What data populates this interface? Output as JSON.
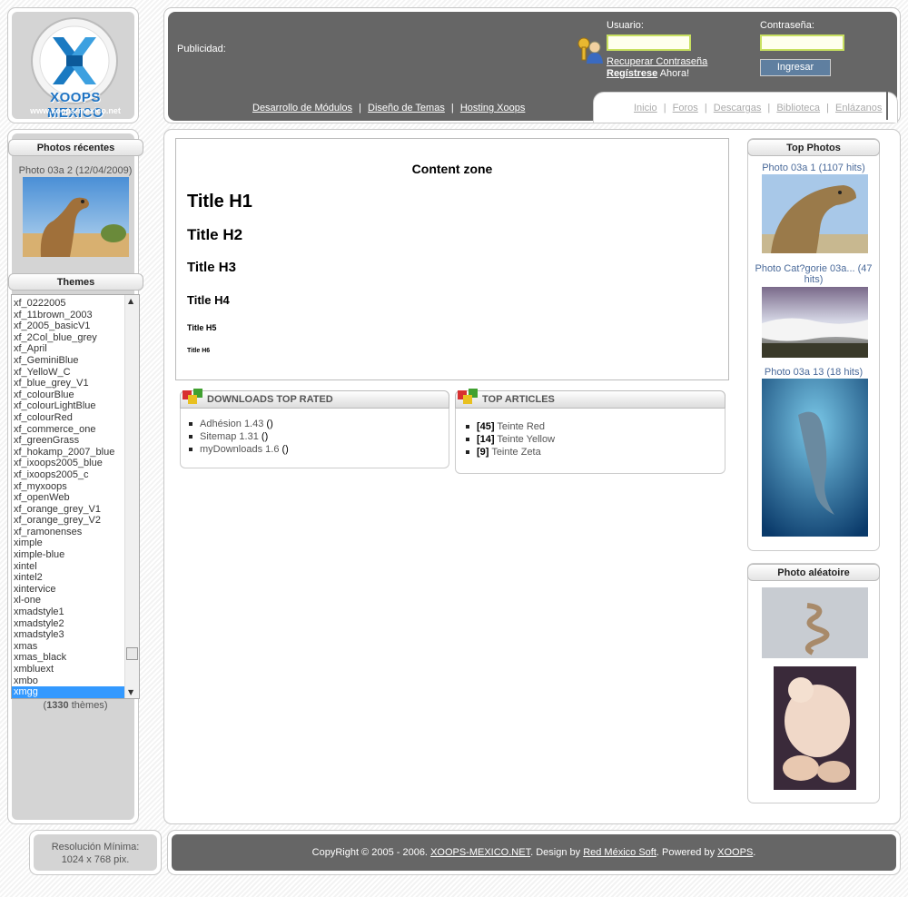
{
  "logo": {
    "title": "XOOPS MEXICO",
    "url_text": "www.xoops-mexico.net"
  },
  "header": {
    "ad_label": "Publicidad:",
    "links": [
      "Desarrollo de Módulos",
      "Diseño de Temas",
      "Hosting Xoops"
    ],
    "separator": "|",
    "username_label": "Usuario:",
    "password_label": "Contraseña:",
    "recover_link": "Recuperar Contraseña",
    "register_link": "Regístrese",
    "register_suffix": "Ahora!",
    "login_button": "Ingresar",
    "nav": [
      "Inicio",
      "Foros",
      "Descargas",
      "Biblioteca",
      "Enlázanos"
    ]
  },
  "left": {
    "recent_title": "Photos récentes",
    "recent_caption": "Photo 03a 2 (12/04/2009)",
    "themes_title": "Themes",
    "themes": [
      "xf_0222005",
      "xf_11brown_2003",
      "xf_2005_basicV1",
      "xf_2Col_blue_grey",
      "xf_April",
      "xf_GeminiBlue",
      "xf_YelloW_C",
      "xf_blue_grey_V1",
      "xf_colourBlue",
      "xf_colourLightBlue",
      "xf_colourRed",
      "xf_commerce_one",
      "xf_greenGrass",
      "xf_hokamp_2007_blue",
      "xf_ixoops2005_blue",
      "xf_ixoops2005_c",
      "xf_myxoops",
      "xf_openWeb",
      "xf_orange_grey_V1",
      "xf_orange_grey_V2",
      "xf_ramonenses",
      "ximple",
      "ximple-blue",
      "xintel",
      "xintel2",
      "xintervice",
      "xl-one",
      "xmadstyle1",
      "xmadstyle2",
      "xmadstyle3",
      "xmas",
      "xmas_black",
      "xmbluext",
      "xmbo",
      "xmgg"
    ],
    "themes_count": "1330",
    "themes_count_suffix": "thèmes"
  },
  "content": {
    "zone": "Content zone",
    "h1": "Title H1",
    "h2": "Title H2",
    "h3": "Title H3",
    "h4": "Title H4",
    "h5": "Title H5",
    "h6": "Title H6"
  },
  "downloads": {
    "title": "DOWNLOADS TOP RATED",
    "items": [
      {
        "name": "Adhésion",
        "rating": "1.43",
        "extra": "()"
      },
      {
        "name": "Sitemap",
        "rating": "1.31",
        "extra": "()"
      },
      {
        "name": "myDownloads",
        "rating": "1.6",
        "extra": "()"
      }
    ]
  },
  "articles": {
    "title": "TOP ARTICLES",
    "items": [
      {
        "count": "[45]",
        "name": "Teinte Red"
      },
      {
        "count": "[14]",
        "name": "Teinte Yellow"
      },
      {
        "count": "[9]",
        "name": "Teinte Zeta"
      }
    ]
  },
  "right": {
    "top_title": "Top Photos",
    "top": [
      {
        "caption": "Photo 03a 1 (1107 hits)"
      },
      {
        "caption": "Photo Cat?gorie 03a... (47 hits)"
      },
      {
        "caption": "Photo 03a 13 (18 hits)"
      }
    ],
    "random_title": "Photo aléatoire"
  },
  "footer": {
    "res_line1": "Resolución Mínima:",
    "res_line2": "1024 x 768 pix.",
    "copy_prefix": "CopyRight © 2005 - 2006.",
    "copy_site": "XOOPS-MEXICO.NET",
    "design_by": ". Design by",
    "design_link": "Red México Soft",
    "powered_by": ". Powered by",
    "powered_link": "XOOPS",
    "end": "."
  },
  "colors": {
    "header_bg": "#666666",
    "selected": "#3399ff",
    "link_blue": "#4a6a9a"
  }
}
